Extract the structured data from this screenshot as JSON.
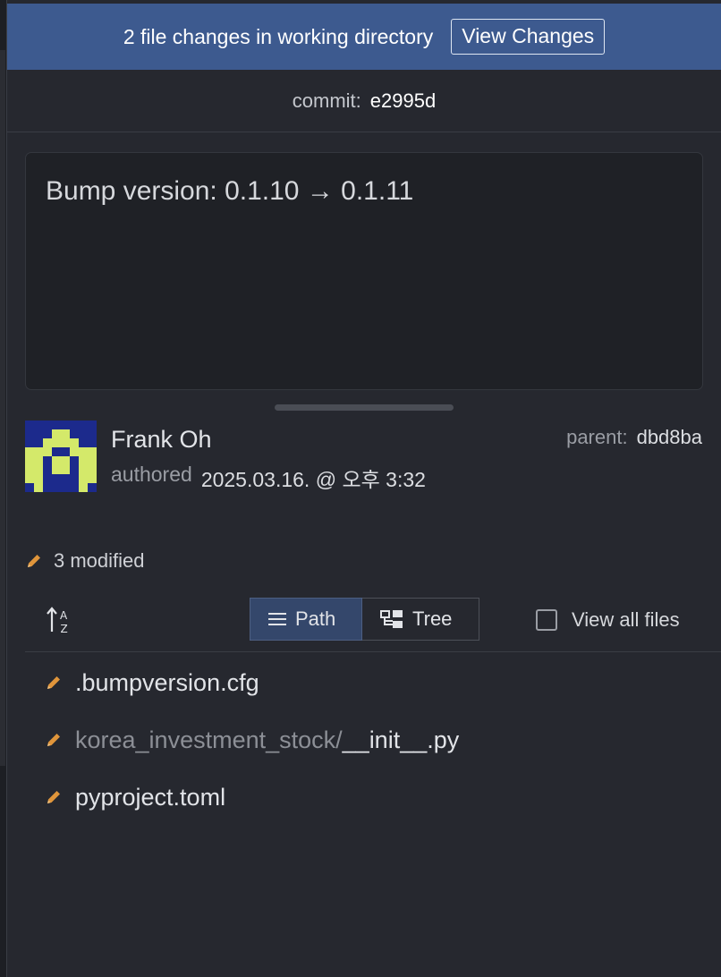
{
  "banner": {
    "text": "2 file changes in working directory",
    "button_label": "View Changes",
    "color": "#3d5a8f"
  },
  "commit": {
    "label": "commit:",
    "hash": "e2995d"
  },
  "message": "Bump version: 0.1.10 → 0.1.11",
  "author": {
    "name": "Frank Oh",
    "authored_label": "authored",
    "date": "2025.03.16. @ 오후 3:32",
    "avatar_colors": {
      "background": "#1c2a8c",
      "foreground": "#d4e96a"
    }
  },
  "parent": {
    "label": "parent:",
    "hash": "dbd8ba"
  },
  "summary": {
    "modified_text": "3 modified",
    "icon": "pencil-icon",
    "accent": "#e0953b"
  },
  "toolbar": {
    "sort_icon": "sort-az-icon",
    "path_label": "Path",
    "tree_label": "Tree",
    "view_all_label": "View all files",
    "view_all_checked": false
  },
  "files": [
    {
      "dir": "",
      "name": ".bumpversion.cfg",
      "status": "modified"
    },
    {
      "dir": "korea_investment_stock/",
      "name": "__init__.py",
      "status": "modified"
    },
    {
      "dir": "",
      "name": "pyproject.toml",
      "status": "modified"
    }
  ]
}
